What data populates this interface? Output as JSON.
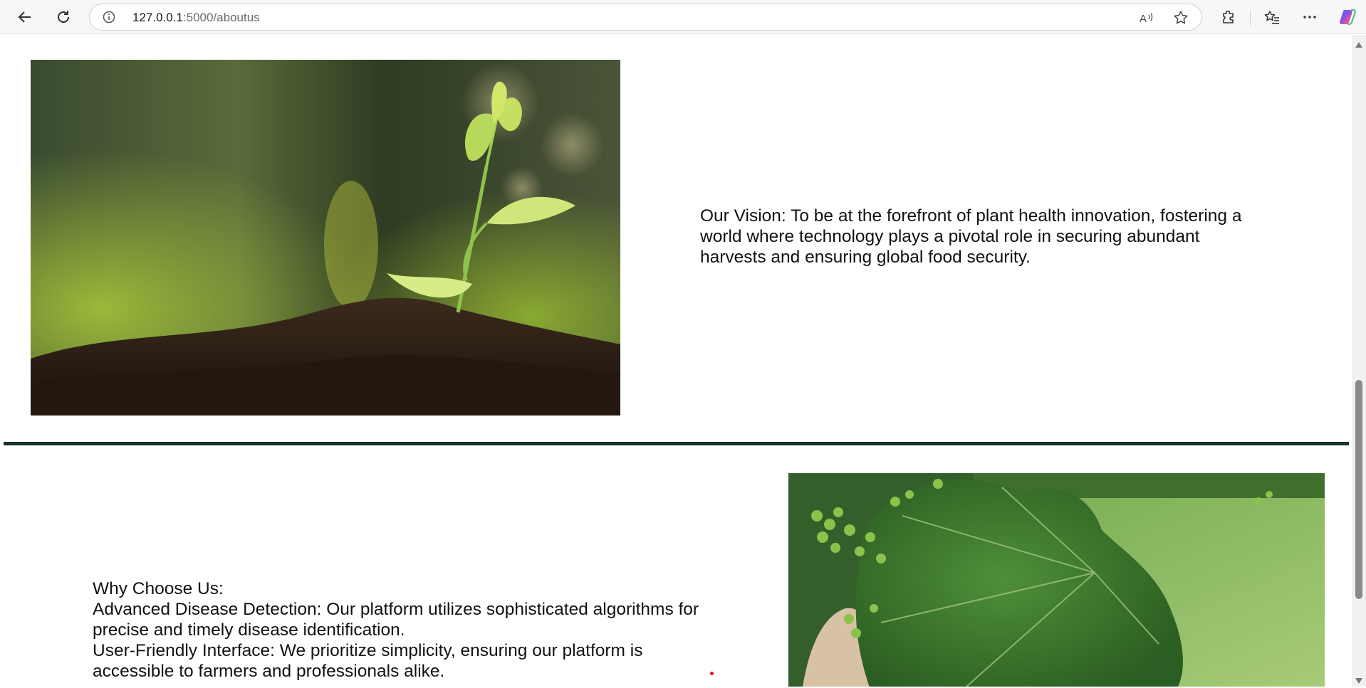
{
  "browser": {
    "url_host": "127.0.0.1",
    "url_path": ":5000/aboutus",
    "icons": [
      "back-icon",
      "refresh-icon",
      "info-icon",
      "read-aloud-icon",
      "favorite-star-icon",
      "extensions-icon",
      "favorites-icon",
      "more-icon",
      "copilot-icon"
    ]
  },
  "vision": {
    "text": "Our Vision: To be at the forefront of plant health innovation, fostering a world where technology plays a pivotal role in securing abundant harvests and ensuring global food security."
  },
  "why": {
    "heading": "Why Choose Us:",
    "point1": "Advanced Disease Detection: Our platform utilizes sophisticated algorithms for precise and timely disease identification.",
    "point2": "User-Friendly Interface: We prioritize simplicity, ensuring our platform is accessible to farmers and professionals alike."
  },
  "colors": {
    "accent_rule": "#17342a",
    "dot": "#ee1111"
  }
}
